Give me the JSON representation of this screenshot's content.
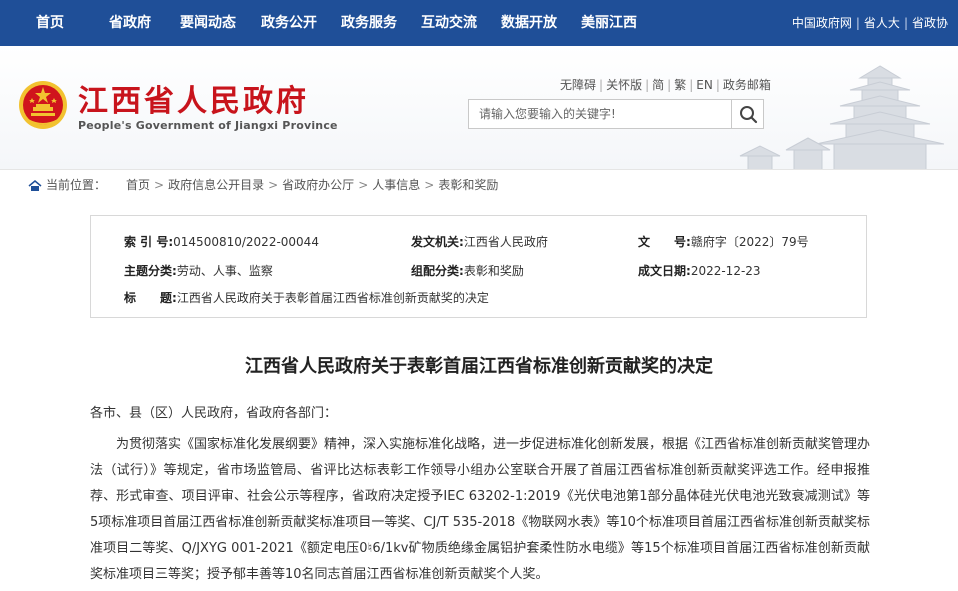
{
  "nav": {
    "items": [
      "首页",
      "省政府",
      "要闻动态",
      "政务公开",
      "政务服务",
      "互动交流",
      "数据开放",
      "美丽江西"
    ],
    "links": [
      "中国政府网",
      "省人大",
      "省政协"
    ]
  },
  "header": {
    "title": "江西省人民政府",
    "subtitle": "People's Government of Jiangxi Province",
    "tools": [
      "无障碍",
      "关怀版",
      "简",
      "繁",
      "EN",
      "政务邮箱"
    ],
    "search_placeholder": "请输入您要输入的关键字!"
  },
  "breadcrumb": {
    "label": "当前位置：",
    "items": [
      "首页",
      "政府信息公开目录",
      "省政府办公厅",
      "人事信息",
      "表彰和奖励"
    ]
  },
  "info": {
    "index_label": "索 引 号:",
    "index_value": "014500810/2022-00044",
    "issuer_label": "发文机关:",
    "issuer_value": "江西省人民政府",
    "docno_label": "文　　号:",
    "docno_value": "赣府字〔2022〕79号",
    "topic_label": "主题分类:",
    "topic_value": "劳动、人事、监察",
    "org_label": "组配分类:",
    "org_value": "表彰和奖励",
    "date_label": "成文日期:",
    "date_value": "2022-12-23",
    "subject_label": "标　　题:",
    "subject_value": "江西省人民政府关于表彰首届江西省标准创新贡献奖的决定"
  },
  "article": {
    "title": "江西省人民政府关于表彰首届江西省标准创新贡献奖的决定",
    "greeting": "各市、县（区）人民政府，省政府各部门：",
    "paragraph": "为贯彻落实《国家标准化发展纲要》精神，深入实施标准化战略，进一步促进标准化创新发展，根据《江西省标准创新贡献奖管理办法（试行）》等规定，省市场监管局、省评比达标表彰工作领导小组办公室联合开展了首届江西省标准创新贡献奖评选工作。经申报推荐、形式审查、项目评审、社会公示等程序，省政府决定授予IEC 63202-1:2019《光伏电池第1部分晶体硅光伏电池光致衰减测试》等5项标准项目首届江西省标准创新贡献奖标准项目一等奖、CJ/T 535-2018《物联网水表》等10个标准项目首届江西省标准创新贡献奖标准项目二等奖、Q/JXYG 001-2021《额定电压0♮6/1kv矿物质绝缘金属铝护套柔性防水电缆》等15个标准项目首届江西省标准创新贡献奖标准项目三等奖；授予郁丰善等10名同志首届江西省标准创新贡献奖个人奖。"
  },
  "colors": {
    "nav_bg": "#1f4f98",
    "title_red": "#c8141c",
    "emblem_gold": "#f2c230"
  }
}
